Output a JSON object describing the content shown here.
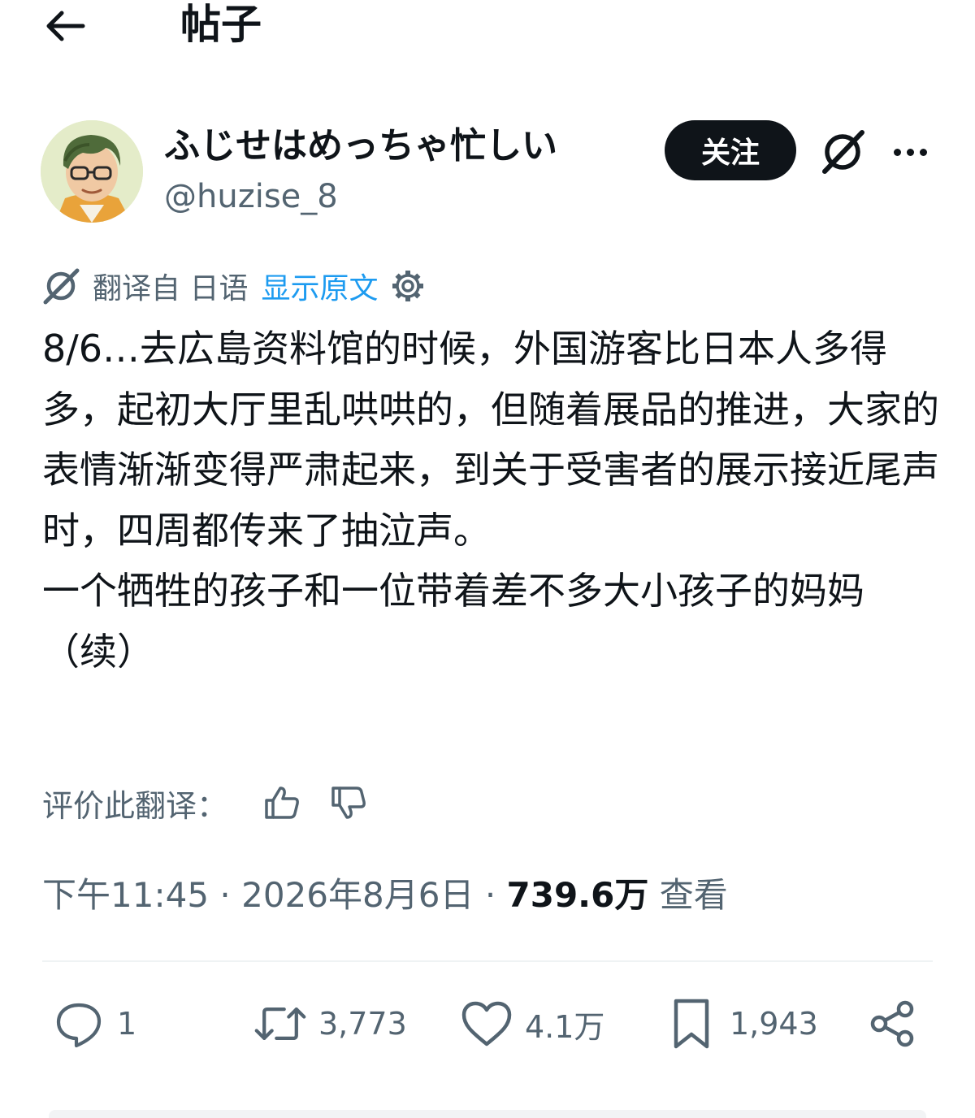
{
  "header": {
    "back_label": "",
    "title": "帖子"
  },
  "author": {
    "display_name": "ふじせはめっちゃ忙しい",
    "handle": "@huzise_8",
    "follow_label": "关注"
  },
  "translation": {
    "translated_from": "翻译自 日语",
    "show_original": "显示原文"
  },
  "post": {
    "text": "8/6…去広島资料馆的时候，外国游客比日本人多得多，起初大厅里乱哄哄的，但随着展品的推进，大家的表情渐渐变得严肃起来，到关于受害者的展示接近尾声时，四周都传来了抽泣声。\n一个牺牲的孩子和一位带着差不多大小孩子的妈妈\n（续）"
  },
  "rate": {
    "label": "评价此翻译："
  },
  "meta": {
    "time": "下午11:45",
    "date": "2026年8月6日",
    "views_count": "739.6万",
    "views_label": "查看"
  },
  "actions": {
    "replies": "1",
    "reposts": "3,773",
    "likes": "4.1万",
    "bookmarks": "1,943"
  },
  "icons": {
    "back": "arrow-left-icon",
    "grok": "grok-icon",
    "more": "more-icon",
    "translate": "grok-icon",
    "settings": "gear-icon",
    "thumbs_up": "thumbs-up-icon",
    "thumbs_down": "thumbs-down-icon",
    "reply": "reply-icon",
    "repost": "repost-icon",
    "like": "heart-icon",
    "bookmark": "bookmark-icon",
    "share": "share-icon"
  },
  "colors": {
    "text": "#0f1419",
    "muted": "#536471",
    "link": "#1d9bf0",
    "follow_bg": "#0f1419"
  }
}
